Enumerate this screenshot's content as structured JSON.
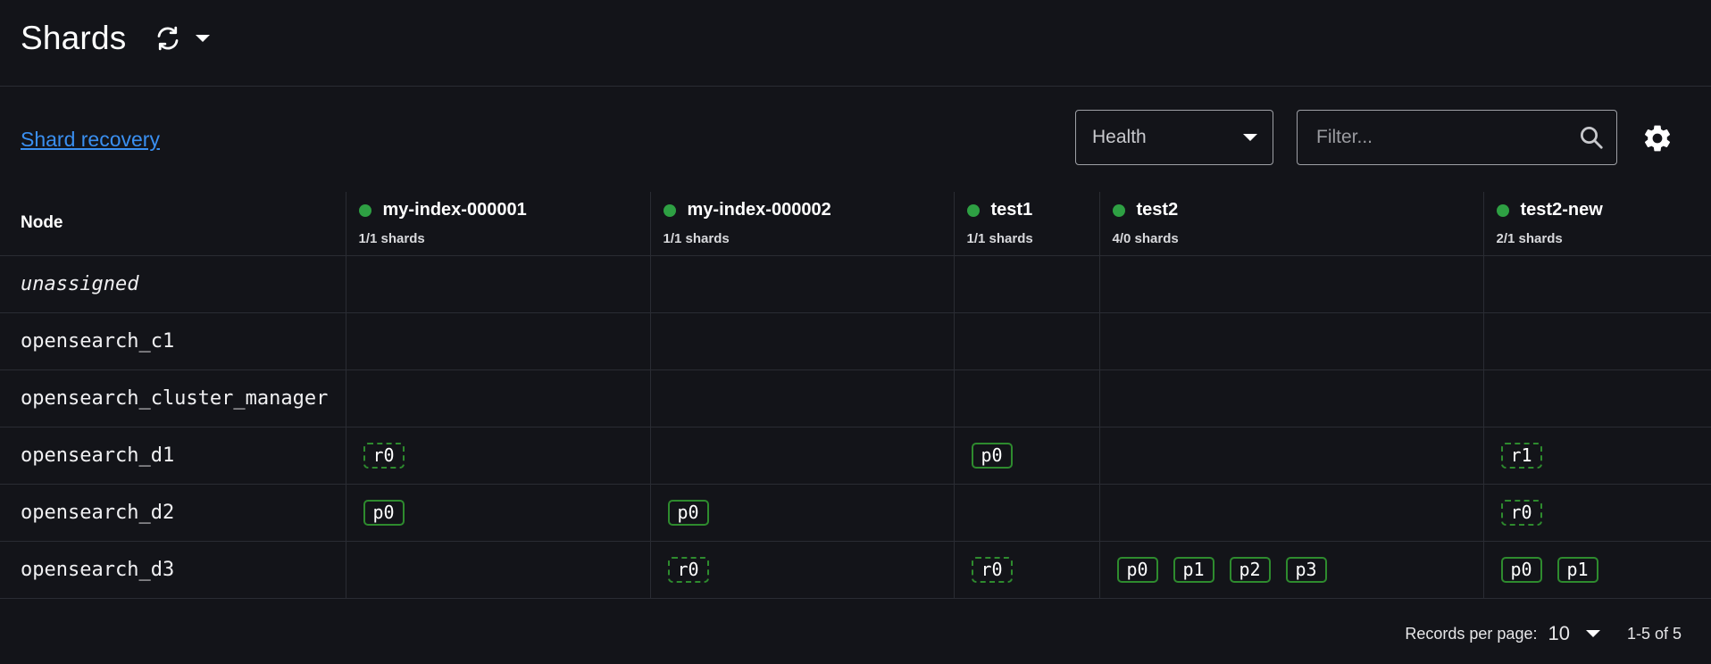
{
  "header": {
    "title": "Shards",
    "refresh_icon": "refresh-icon",
    "menu_icon": "chevron-down-icon"
  },
  "toolbar": {
    "recovery_link": "Shard recovery",
    "health_select": "Health",
    "filter_placeholder": "Filter...",
    "search_icon": "search-icon",
    "settings_icon": "gear-icon"
  },
  "table": {
    "node_header": "Node",
    "indices": [
      {
        "name": "my-index-000001",
        "shards": "1/1 shards",
        "health": "green"
      },
      {
        "name": "my-index-000002",
        "shards": "1/1 shards",
        "health": "green"
      },
      {
        "name": "test1",
        "shards": "1/1 shards",
        "health": "green"
      },
      {
        "name": "test2",
        "shards": "4/0 shards",
        "health": "green"
      },
      {
        "name": "test2-new",
        "shards": "2/1 shards",
        "health": "green"
      }
    ],
    "rows": [
      {
        "node": "unassigned",
        "cells": [
          [],
          [],
          [],
          [],
          []
        ]
      },
      {
        "node": "opensearch_c1",
        "cells": [
          [],
          [],
          [],
          [],
          []
        ]
      },
      {
        "node": "opensearch_cluster_manager",
        "cells": [
          [],
          [],
          [],
          [],
          []
        ]
      },
      {
        "node": "opensearch_d1",
        "cells": [
          [
            "r0"
          ],
          [],
          [
            "p0"
          ],
          [],
          [
            "r1"
          ]
        ]
      },
      {
        "node": "opensearch_d2",
        "cells": [
          [
            "p0"
          ],
          [
            "p0"
          ],
          [],
          [],
          [
            "r0"
          ]
        ]
      },
      {
        "node": "opensearch_d3",
        "cells": [
          [],
          [
            "r0"
          ],
          [
            "r0"
          ],
          [
            "p0",
            "p1",
            "p2",
            "p3"
          ],
          [
            "p0",
            "p1"
          ]
        ]
      }
    ]
  },
  "pagination": {
    "records_label": "Records per page:",
    "per_page": "10",
    "range": "1-5 of 5"
  },
  "colors": {
    "background": "#131419",
    "health_green": "#2ea043",
    "chip_border": "#2e8b2e",
    "link": "#3a8ff0"
  }
}
